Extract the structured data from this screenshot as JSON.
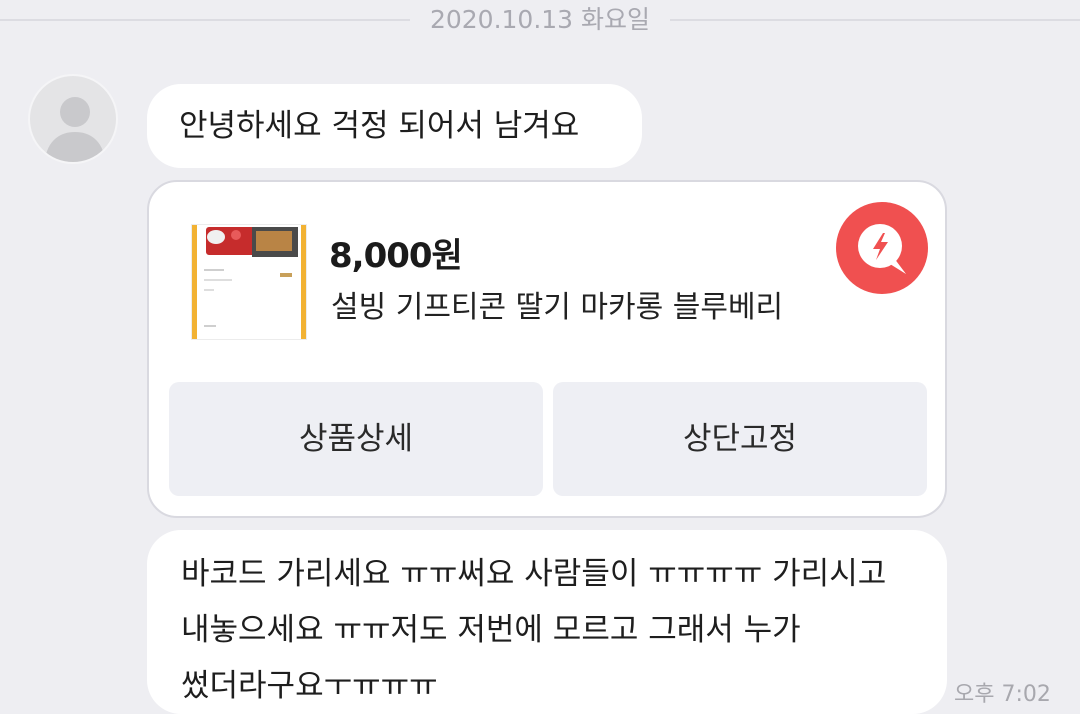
{
  "date_divider": "2020.10.13 화요일",
  "messages": {
    "greeting": "안녕하세요 걱정 되어서 남겨요",
    "product_card": {
      "price": "8,000원",
      "name": "설빙 기프티콘 딸기 마카롱 블루베리",
      "detail_button": "상품상세",
      "pin_button": "상단고정",
      "badge_icon": "lightning-search-icon",
      "badge_color": "#f05050"
    },
    "barcode_lines": [
      "바코드 가리세요 ㅠㅠ써요 사람들이 ㅠㅠㅠㅠ 가리시고",
      "내놓으세요 ㅠㅠ저도 저번에 모르고 그래서 누가",
      "썼더라구요ㅜㅠㅠㅠ"
    ],
    "time": "오후 7:02"
  }
}
